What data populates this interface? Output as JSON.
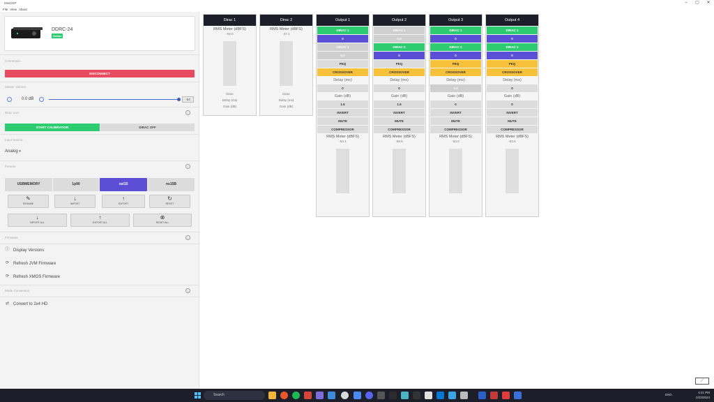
{
  "window": {
    "title": "MiniDSP",
    "controls": [
      "–",
      "▢",
      "✕"
    ]
  },
  "menu": [
    "File",
    "View",
    "About"
  ],
  "device": {
    "name": "DDRC-24",
    "status": "Online"
  },
  "sidebar": {
    "connection": {
      "label": "Connection",
      "button": "DISCONNECT"
    },
    "master_volume": {
      "label": "Master Volume",
      "value": "0.0 dB",
      "level": 1.0,
      "box": "-54"
    },
    "dirac_live": {
      "label": "Dirac Live",
      "start": "START CALIBRATION",
      "off": "DIRAC OFF"
    },
    "input_source": {
      "label": "Input Source",
      "value": "Analog"
    },
    "presets": {
      "label": "Presets",
      "tabs": [
        "USBMEMORY",
        "1p90",
        "nsl15",
        "ns15B"
      ],
      "active_index": 2,
      "actions_row1": [
        {
          "glyph": "✎",
          "label": "RENAME"
        },
        {
          "glyph": "↓",
          "label": "IMPORT"
        },
        {
          "glyph": "↑",
          "label": "EXPORT"
        },
        {
          "glyph": "↻",
          "label": "RESET"
        }
      ],
      "actions_row2": [
        {
          "glyph": "↓",
          "label": "IMPORT ALL"
        },
        {
          "glyph": "↑",
          "label": "EXPORT ALL"
        },
        {
          "glyph": "⊗",
          "label": "RESET ALL"
        }
      ]
    },
    "firmware": {
      "label": "Firmware",
      "items": [
        {
          "icon": "info-icon",
          "text": "Display Versions"
        },
        {
          "icon": "refresh-icon",
          "text": "Refresh JVM Firmware"
        },
        {
          "icon": "refresh-icon",
          "text": "Refresh XMOS Firmware"
        }
      ]
    },
    "mode_conversion": {
      "label": "Mode Conversion",
      "items": [
        {
          "icon": "convert-icon",
          "text": "Convert to 2x4 HD"
        }
      ]
    }
  },
  "inputs": [
    {
      "title": "Dirac 1",
      "meter_label": "RMS Meter (dBFS)",
      "meter_value": "-52.0",
      "lines": [
        "Dirac",
        "Delay (ms)",
        "Gain (dB)"
      ]
    },
    {
      "title": "Dirac 2",
      "meter_label": "RMS Meter (dBFS)",
      "meter_value": "-37.1",
      "lines": [
        "Dirac",
        "Delay (ms)",
        "Gain (dB)"
      ]
    }
  ],
  "outputs": [
    {
      "title": "Output 1",
      "rows": [
        {
          "text": "DIRAC 1",
          "style": "green"
        },
        {
          "text": "0",
          "style": "blue"
        },
        {
          "text": "DIRAC 2",
          "style": "gray"
        },
        {
          "text": "0.0",
          "style": "gray"
        },
        {
          "text": "PEQ",
          "style": "light"
        },
        {
          "text": "CROSSOVER",
          "style": "yellow"
        },
        {
          "text": "Delay (ms)",
          "style": "text"
        },
        {
          "text": "0",
          "style": "light"
        },
        {
          "text": "Gain (dB)",
          "style": "text"
        },
        {
          "text": "1.6",
          "style": "light"
        },
        {
          "text": "INVERT",
          "style": "light"
        },
        {
          "text": "MUTE",
          "style": "light"
        },
        {
          "text": "COMPRESSOR",
          "style": "light"
        }
      ],
      "meter_label": "RMS Meter (dBFS)",
      "meter_value": "-54.1"
    },
    {
      "title": "Output 2",
      "rows": [
        {
          "text": "DIRAC 1",
          "style": "gray"
        },
        {
          "text": "0.0",
          "style": "gray"
        },
        {
          "text": "DIRAC 2",
          "style": "green"
        },
        {
          "text": "0",
          "style": "blue"
        },
        {
          "text": "PEQ",
          "style": "light"
        },
        {
          "text": "CROSSOVER",
          "style": "yellow"
        },
        {
          "text": "Delay (ms)",
          "style": "text"
        },
        {
          "text": "0",
          "style": "light"
        },
        {
          "text": "Gain (dB)",
          "style": "text"
        },
        {
          "text": "1.6",
          "style": "light"
        },
        {
          "text": "INVERT",
          "style": "light"
        },
        {
          "text": "MUTE",
          "style": "light"
        },
        {
          "text": "COMPRESSOR",
          "style": "light"
        }
      ],
      "meter_label": "RMS Meter (dBFS)",
      "meter_value": "-55.5"
    },
    {
      "title": "Output 3",
      "rows": [
        {
          "text": "DIRAC 1",
          "style": "green"
        },
        {
          "text": "0",
          "style": "blue"
        },
        {
          "text": "DIRAC 2",
          "style": "green"
        },
        {
          "text": "0",
          "style": "blue"
        },
        {
          "text": "PEQ",
          "style": "yellow"
        },
        {
          "text": "CROSSOVER",
          "style": "yellow"
        },
        {
          "text": "Delay (ms)",
          "style": "text"
        },
        {
          "text": "4.2",
          "style": "gray"
        },
        {
          "text": "Gain (dB)",
          "style": "text"
        },
        {
          "text": "0",
          "style": "light"
        },
        {
          "text": "INVERT",
          "style": "light"
        },
        {
          "text": "MUTE",
          "style": "light"
        },
        {
          "text": "COMPRESSOR",
          "style": "light"
        }
      ],
      "meter_label": "RMS Meter (dBFS)",
      "meter_value": "-53.0"
    },
    {
      "title": "Output 4",
      "rows": [
        {
          "text": "DIRAC 1",
          "style": "green"
        },
        {
          "text": "0",
          "style": "blue"
        },
        {
          "text": "DIRAC 2",
          "style": "green"
        },
        {
          "text": "0",
          "style": "blue"
        },
        {
          "text": "PEQ",
          "style": "yellow"
        },
        {
          "text": "CROSSOVER",
          "style": "yellow"
        },
        {
          "text": "Delay (ms)",
          "style": "text"
        },
        {
          "text": "0",
          "style": "light"
        },
        {
          "text": "Gain (dB)",
          "style": "text"
        },
        {
          "text": "0",
          "style": "light"
        },
        {
          "text": "INVERT",
          "style": "light"
        },
        {
          "text": "MUTE",
          "style": "light"
        },
        {
          "text": "COMPRESSOR",
          "style": "light"
        }
      ],
      "meter_label": "RMS Meter (dBFS)",
      "meter_value": "-53.6"
    }
  ],
  "taskbar": {
    "search": "Search",
    "time": "4:41 PM",
    "date": "2/23/2024",
    "lang": "ENG"
  },
  "colors": {
    "green": "#2ecc71",
    "blue": "#5b4fd6",
    "yellow": "#f8c13a",
    "red": "#e84a5f",
    "header": "#1e1e2a"
  }
}
